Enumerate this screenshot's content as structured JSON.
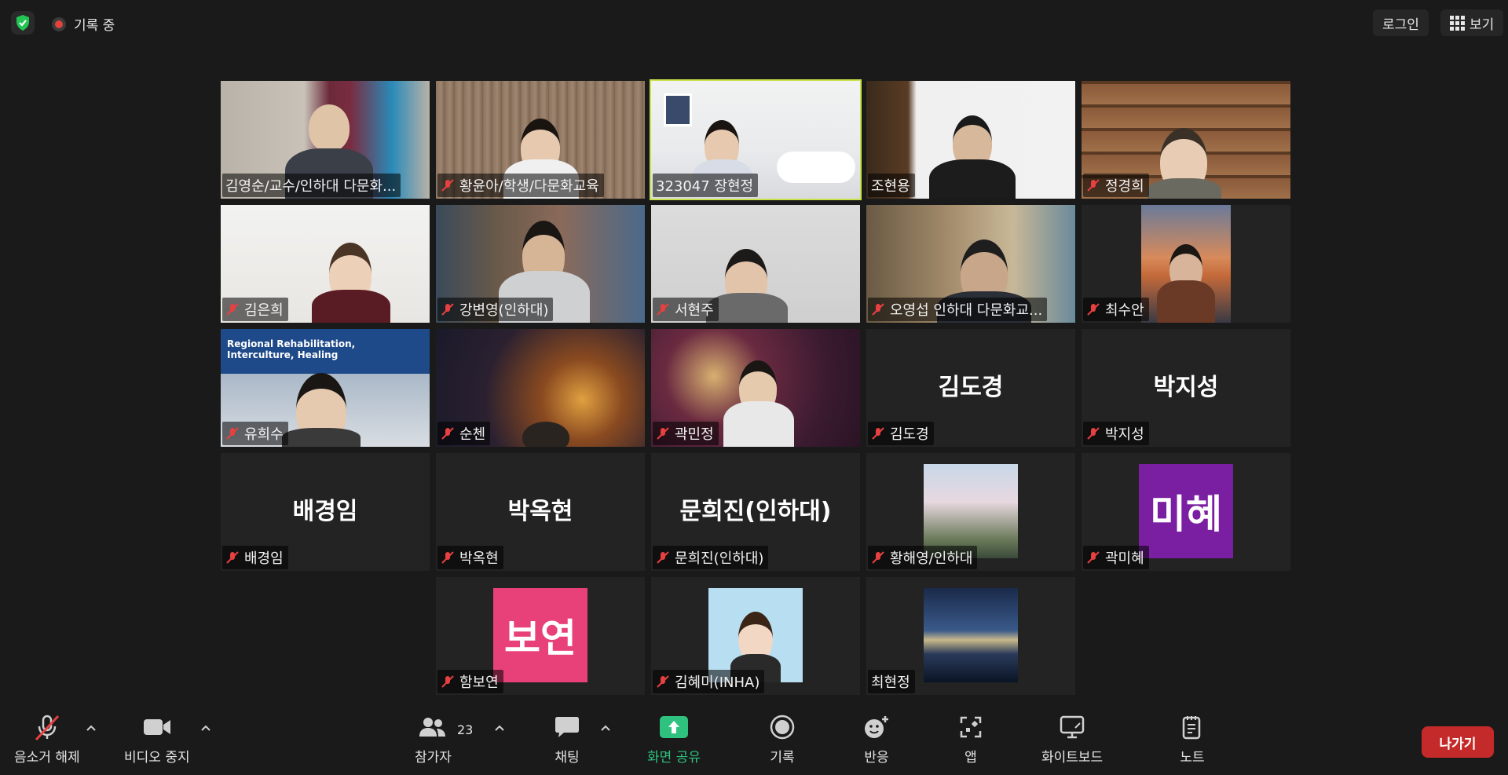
{
  "topbar": {
    "recording_label": "기록 중",
    "login_label": "로그인",
    "view_label": "보기"
  },
  "tiles": [
    {
      "name": "김영순/교수/인하대 다문화...",
      "muted": false,
      "kind": "video"
    },
    {
      "name": "황윤아/학생/다문화교육",
      "muted": true,
      "kind": "video"
    },
    {
      "name": "323047 장현정",
      "muted": false,
      "kind": "video",
      "active": true
    },
    {
      "name": "조현용",
      "muted": false,
      "kind": "video"
    },
    {
      "name": "정경희",
      "muted": true,
      "kind": "video"
    },
    {
      "name": "김은희",
      "muted": true,
      "kind": "video"
    },
    {
      "name": "강변영(인하대)",
      "muted": true,
      "kind": "video"
    },
    {
      "name": "서현주",
      "muted": true,
      "kind": "video"
    },
    {
      "name": "오영섭 인하대 다문화교...",
      "muted": true,
      "kind": "video"
    },
    {
      "name": "최수안",
      "muted": true,
      "kind": "avatar-photo"
    },
    {
      "name": "유희수",
      "muted": true,
      "kind": "video",
      "banner_line1": "Regional Rehabilitation,",
      "banner_line2": "Interculture, Healing"
    },
    {
      "name": "순첸",
      "muted": true,
      "kind": "video"
    },
    {
      "name": "곽민정",
      "muted": true,
      "kind": "video"
    },
    {
      "name": "김도경",
      "muted": true,
      "kind": "name-only",
      "big": "김도경"
    },
    {
      "name": "박지성",
      "muted": true,
      "kind": "name-only",
      "big": "박지성"
    },
    {
      "name": "배경임",
      "muted": true,
      "kind": "name-only",
      "big": "배경임"
    },
    {
      "name": "박옥현",
      "muted": true,
      "kind": "name-only",
      "big": "박옥현"
    },
    {
      "name": "문희진(인하대)",
      "muted": true,
      "kind": "name-only",
      "big": "문희진(인하대)"
    },
    {
      "name": "황해영/인하대",
      "muted": true,
      "kind": "avatar-photo"
    },
    {
      "name": "곽미혜",
      "muted": true,
      "kind": "avatar-text",
      "avatar_text": "미혜",
      "avatar_color": "#7b1fa2"
    },
    {
      "name": "함보연",
      "muted": true,
      "kind": "avatar-text",
      "avatar_text": "보연",
      "avatar_color": "#e8417a"
    },
    {
      "name": "김혜미(INHA)",
      "muted": true,
      "kind": "avatar-photo"
    },
    {
      "name": "최현정",
      "muted": false,
      "kind": "avatar-photo"
    }
  ],
  "toolbar": {
    "unmute_label": "음소거 해제",
    "video_label": "비디오 중지",
    "participants_label": "참가자",
    "participants_count": "23",
    "chat_label": "채팅",
    "share_label": "화면 공유",
    "record_label": "기록",
    "reactions_label": "반응",
    "apps_label": "앱",
    "whiteboard_label": "화이트보드",
    "notes_label": "노트",
    "leave_label": "나가기"
  },
  "colors": {
    "active_speaker": "#c8e34a",
    "share_green": "#2ec27e",
    "leave_red": "#c52a2a",
    "background": "#1a1a1a"
  }
}
